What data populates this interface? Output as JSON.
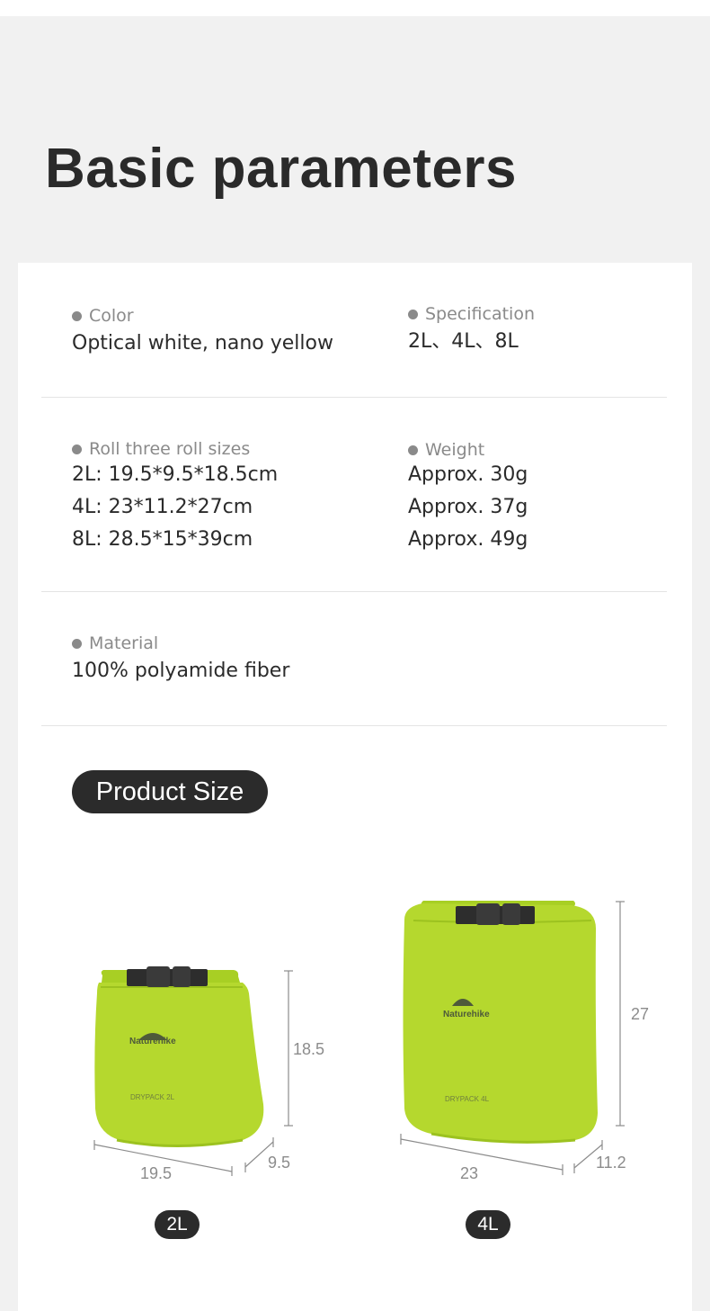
{
  "title": "Basic parameters",
  "specs": {
    "color": {
      "label": "Color",
      "value": "Optical white, nano yellow"
    },
    "specification": {
      "label": "Specification",
      "value": "2L、4L、8L"
    },
    "roll_sizes": {
      "label": "Roll three roll sizes",
      "values": [
        "2L: 19.5*9.5*18.5cm",
        "4L: 23*11.2*27cm",
        "8L: 28.5*15*39cm"
      ]
    },
    "weight": {
      "label": "Weight",
      "values": [
        "Approx. 30g",
        "Approx. 37g",
        "Approx. 49g"
      ]
    },
    "material": {
      "label": "Material",
      "value": "100% polyamide fiber"
    }
  },
  "product_size": {
    "heading": "Product Size",
    "bags": [
      {
        "size_label": "2L",
        "brand": "Naturehike",
        "print": "DRYPACK 2L",
        "height": "18.5",
        "width": "19.5",
        "depth": "9.5"
      },
      {
        "size_label": "4L",
        "brand": "Naturehike",
        "print": "DRYPACK 4L",
        "height": "27",
        "width": "23",
        "depth": "11.2"
      }
    ]
  },
  "colors": {
    "bag_green": "#b5d82e",
    "bag_shade": "#9cc21f",
    "buckle": "#2d2d2d",
    "pill_bg": "#2b2b2b",
    "background": "#f1f1f1",
    "card": "#ffffff"
  }
}
